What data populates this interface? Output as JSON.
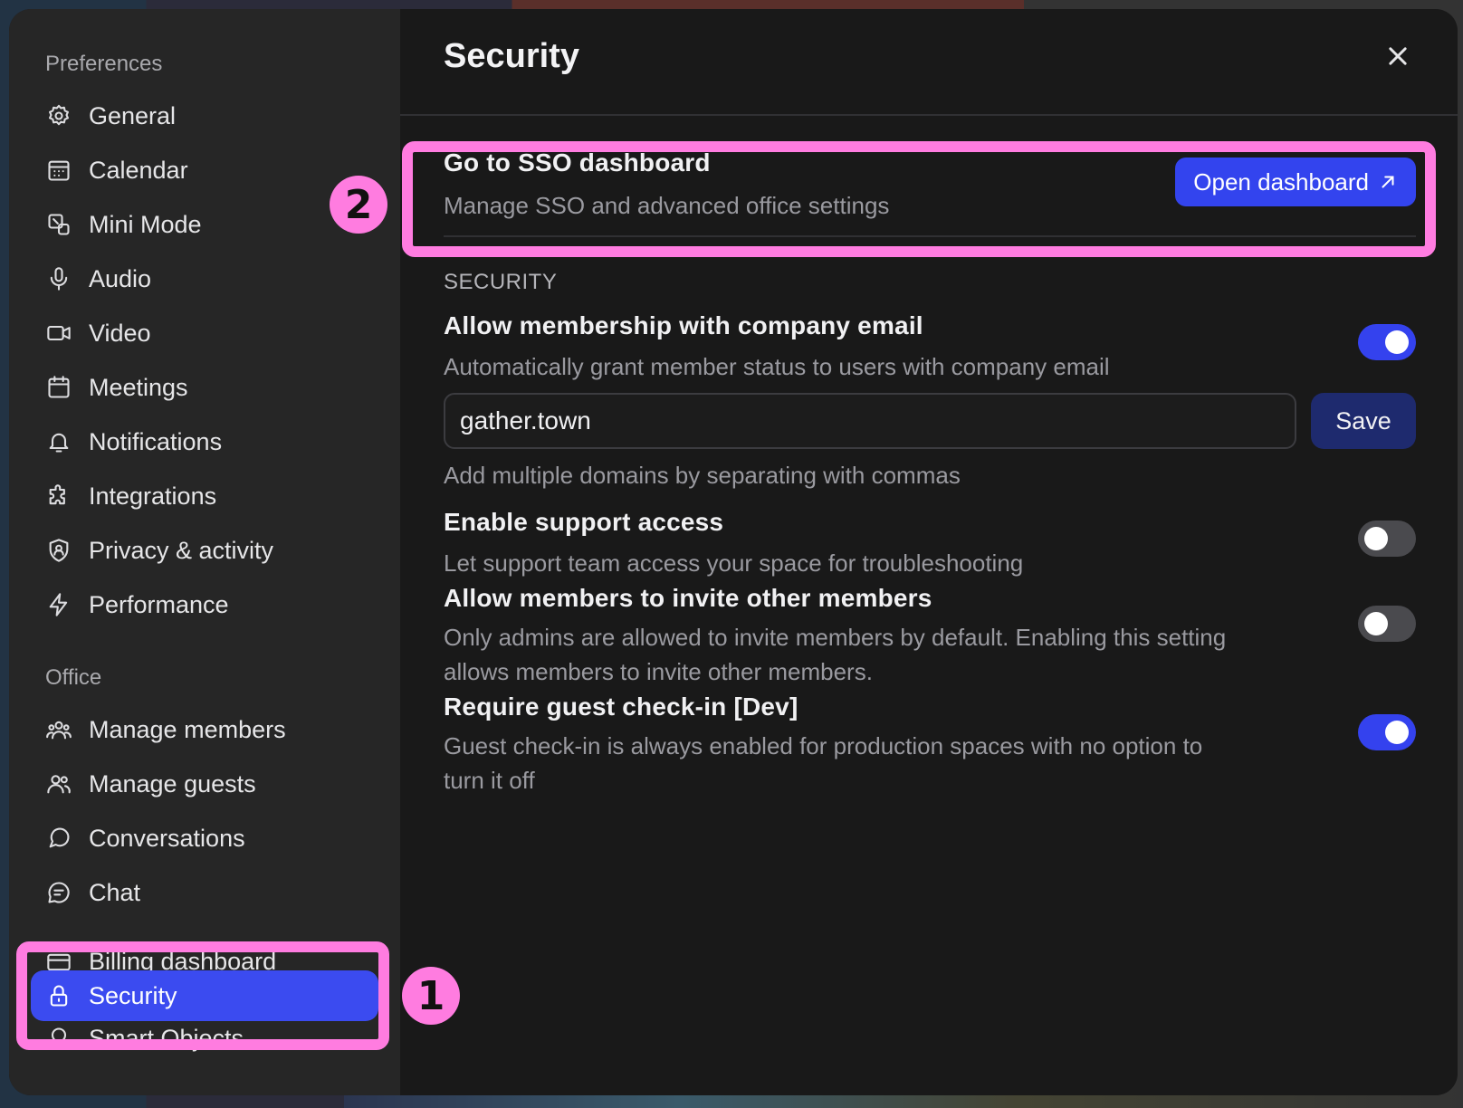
{
  "sidebar": {
    "preferences_label": "Preferences",
    "office_label": "Office",
    "preferences_items": [
      {
        "label": "General",
        "icon": "gear-icon"
      },
      {
        "label": "Calendar",
        "icon": "calendar-icon"
      },
      {
        "label": "Mini Mode",
        "icon": "mini-mode-icon"
      },
      {
        "label": "Audio",
        "icon": "microphone-icon"
      },
      {
        "label": "Video",
        "icon": "video-camera-icon"
      },
      {
        "label": "Meetings",
        "icon": "meetings-calendar-icon"
      },
      {
        "label": "Notifications",
        "icon": "bell-icon"
      },
      {
        "label": "Integrations",
        "icon": "puzzle-icon"
      },
      {
        "label": "Privacy & activity",
        "icon": "shield-icon"
      },
      {
        "label": "Performance",
        "icon": "lightning-icon"
      }
    ],
    "office_items": [
      {
        "label": "Manage members",
        "icon": "members-icon"
      },
      {
        "label": "Manage guests",
        "icon": "guests-icon"
      },
      {
        "label": "Conversations",
        "icon": "conversations-icon"
      },
      {
        "label": "Chat",
        "icon": "chat-icon"
      },
      {
        "label": "Billing dashboard",
        "icon": "billing-icon"
      },
      {
        "label": "Security",
        "icon": "lock-icon",
        "active": true
      },
      {
        "label": "Smart Objects",
        "icon": "smart-objects-icon"
      }
    ]
  },
  "header": {
    "title": "Security"
  },
  "sso": {
    "title": "Go to SSO dashboard",
    "description": "Manage SSO and advanced office settings",
    "button_label": "Open dashboard"
  },
  "security_section": {
    "heading": "SECURITY",
    "settings": [
      {
        "title": "Allow membership with company email",
        "description": "Automatically grant member status to users with company email",
        "enabled": true
      },
      {
        "title": "Enable support access",
        "description": "Let support team access your space for troubleshooting",
        "enabled": false
      },
      {
        "title": "Allow members to invite other members",
        "description": "Only admins are allowed to invite members by default. Enabling this setting allows members to invite other members.",
        "enabled": false
      },
      {
        "title": "Require guest check-in [Dev]",
        "description": "Guest check-in is always enabled for production spaces with no option to turn it off",
        "enabled": true
      }
    ],
    "domain_input_value": "gather.town",
    "save_label": "Save",
    "domain_hint": "Add multiple domains by separating with commas"
  },
  "annotations": {
    "badge_1": "1",
    "badge_2": "2"
  },
  "colors": {
    "accent": "#3b4bf0",
    "annotation": "#ff7ce0",
    "save_button": "#1e2a6e"
  }
}
